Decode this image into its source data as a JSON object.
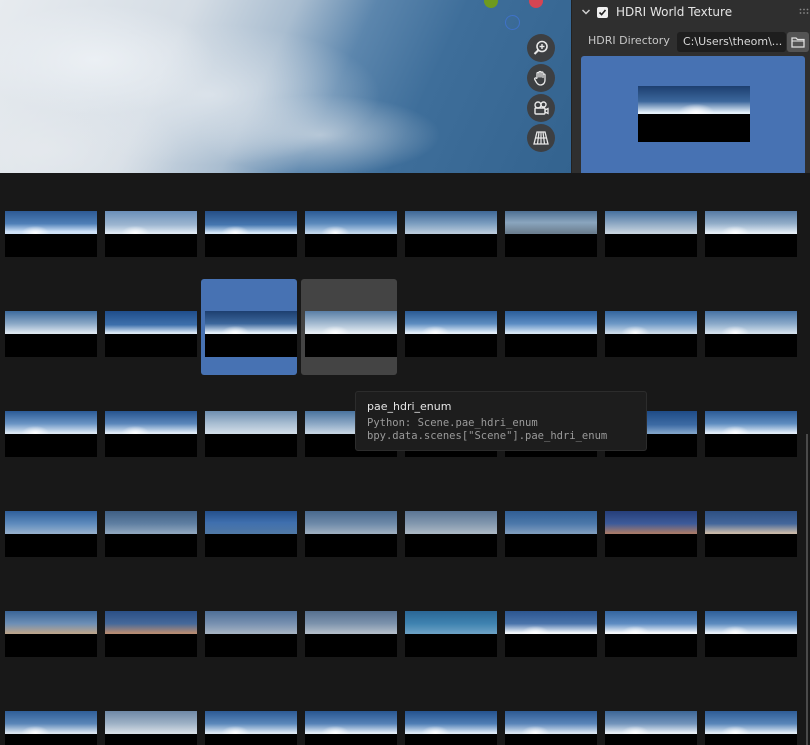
{
  "panel": {
    "header_title": "HDRI World Texture",
    "hdri_directory_label": "HDRI Directory",
    "hdri_directory_value": "C:\\Users\\theom\\...",
    "enabled": true
  },
  "viewport": {
    "icons": [
      "gizmo-y-axis",
      "gizmo-x-axis",
      "zoom-icon",
      "hand-icon",
      "camera-icon",
      "grid-icon"
    ]
  },
  "tooltip": {
    "title": "pae_hdri_enum",
    "python_line": "Python: Scene.pae_hdri_enum",
    "bpy_line": "bpy.data.scenes[\"Scene\"].pae_hdri_enum"
  },
  "grid": {
    "rows": [
      [
        {
          "sky": "linear-gradient(180deg,#2d5a94 0%,#4f7fb7 55%,#cfe2f7 90%)",
          "sun": true
        },
        {
          "sky": "linear-gradient(180deg,#6a8fb9 0%,#9db6d0 60%,#dfe9f3 95%)",
          "sun": true
        },
        {
          "sky": "linear-gradient(180deg,#254f87 0%,#4677b0 60%,#d7e8f8 95%)",
          "sun": true
        },
        {
          "sky": "linear-gradient(180deg,#2b5b95 0%,#5d8bbd 55%,#c0d5ea 95%)",
          "sun": true
        },
        {
          "sky": "linear-gradient(180deg,#3e6796 0%,#7c9ec0 55%,#b9cadb 95%)",
          "sun": false
        },
        {
          "sky": "linear-gradient(180deg,#4d6f92 0%,#8aa5be 50%,#6c7f90 95%)",
          "sun": false
        },
        {
          "sky": "linear-gradient(180deg,#45709f 0%,#8fa9c4 55%,#c7d3de 95%)",
          "sun": false
        },
        {
          "sky": "linear-gradient(180deg,#557aa4 0%,#93aec9 55%,#e4edf5 95%)",
          "sun": true
        }
      ],
      [
        {
          "sky": "linear-gradient(180deg,#3d6b9e 0%,#8ba8c6 55%,#dce6ef 95%)",
          "sun": false
        },
        {
          "sky": "linear-gradient(180deg,#1f4d8a 0%,#3d70ac 60%,#dbe8f4 95%)",
          "sun": false
        },
        {
          "sky": "linear-gradient(180deg,#1d3f70 0%,#3c679c 55%,#e5f0fa 95%)",
          "sun": true
        },
        {
          "sky": "linear-gradient(180deg,#597ea6 0%,#a5bbd1 55%,#e6edf3 95%)",
          "sun": true
        },
        {
          "sky": "linear-gradient(180deg,#2a5a94 0%,#5d8cc0 55%,#e3eef8 95%)",
          "sun": true
        },
        {
          "sky": "linear-gradient(180deg,#2b5e9a 0%,#5b8cc3 55%,#d6e5f3 95%)",
          "sun": false
        },
        {
          "sky": "linear-gradient(180deg,#33659e 0%,#6d98c6 55%,#cad9e7 95%)",
          "sun": true
        },
        {
          "sky": "linear-gradient(180deg,#4672a4 0%,#8aa9c9 55%,#d2dfeb 95%)",
          "sun": true
        }
      ],
      [
        {
          "sky": "linear-gradient(180deg,#2a5a96 0%,#6a94c4 55%,#dbe7f3 95%)",
          "sun": true
        },
        {
          "sky": "linear-gradient(180deg,#26548f 0%,#5b87bb 55%,#e0ebf6 95%)",
          "sun": true
        },
        {
          "sky": "linear-gradient(180deg,#6e8eb0 0%,#a9bed2 55%,#d0dce7 95%)",
          "sun": false
        },
        {
          "sky": "linear-gradient(180deg,#49739f 0%,#8ca8c5 55%,#c4d3e1 95%)",
          "sun": false
        },
        {
          "sky": "linear-gradient(180deg,#3d6592 0%,#7395b9 55%,#c5d3e0 95%)",
          "sun": false
        },
        {
          "sky": "linear-gradient(180deg,#2f5d93 0%,#6890bd 55%,#cbd9e6 95%)",
          "sun": false
        },
        {
          "sky": "linear-gradient(180deg,#1e4b86 0%,#3d6ba4 60%,#7fa2c8 95%)",
          "sun": false
        },
        {
          "sky": "linear-gradient(180deg,#2c5b96 0%,#5f8dc0 55%,#e1ecf7 95%)",
          "sun": true
        }
      ],
      [
        {
          "sky": "linear-gradient(180deg,#2f5f9b 0%,#5e8bbd 55%,#93aecb 95%)",
          "sun": false
        },
        {
          "sky": "linear-gradient(180deg,#3f5f84 0%,#5f7fa2 55%,#8ea5bd 95%)",
          "sun": false
        },
        {
          "sky": "linear-gradient(180deg,#24508c 0%,#3f6fae 50%,#4f78a6 95%)",
          "sun": false
        },
        {
          "sky": "linear-gradient(180deg,#49698e 0%,#6e8aa9 55%,#9cadbf 95%)",
          "sun": false
        },
        {
          "sky": "linear-gradient(180deg,#5b7594 0%,#8398ae 55%,#a9b6c3 95%)",
          "sun": false
        },
        {
          "sky": "linear-gradient(180deg,#305e94 0%,#4c78aa 55%,#7d9bbc 95%)",
          "sun": false
        },
        {
          "sky": "linear-gradient(180deg,#263f7a 0%,#3d5b9a 55%,#a67a6a 95%)",
          "sun": false
        },
        {
          "sky": "linear-gradient(180deg,#2d4f82 0%,#44679b 55%,#c8b8a8 95%)",
          "sun": false
        }
      ],
      [
        {
          "sky": "linear-gradient(180deg,#3a6597 0%,#6d8fb6 55%,#b9a48d 95%)",
          "sun": false
        },
        {
          "sky": "linear-gradient(180deg,#2a4f86 0%,#46699a 55%,#b58b73 95%)",
          "sun": false
        },
        {
          "sky": "linear-gradient(180deg,#4e6f97 0%,#7891b0 55%,#a3b1c1 95%)",
          "sun": false
        },
        {
          "sky": "linear-gradient(180deg,#56708f 0%,#7d93ad 55%,#b1bcc8 95%)",
          "sun": false
        },
        {
          "sky": "linear-gradient(180deg,#2a6796 0%,#3f83b0 55%,#6aa0c4 95%)",
          "sun": false
        },
        {
          "sky": "linear-gradient(180deg,#2c5690 0%,#4a74ab 55%,#f3f7fb 95%)",
          "sun": true
        },
        {
          "sky": "linear-gradient(180deg,#3466a0 0%,#5e8cc2 55%,#f5f8fb 95%)",
          "sun": true
        },
        {
          "sky": "linear-gradient(180deg,#2e5f9a 0%,#5c8bbf 55%,#e8f0f8 95%)",
          "sun": true
        }
      ],
      [
        {
          "sky": "linear-gradient(180deg,#2f5e98 0%,#5a86b8 55%,#d9e4ef 95%)",
          "sun": true
        },
        {
          "sky": "linear-gradient(180deg,#6e88a6 0%,#9fb2c6 55%,#d5dde5 95%)",
          "sun": false
        },
        {
          "sky": "linear-gradient(180deg,#2c5a94 0%,#5b88bb 55%,#dce8f3 95%)",
          "sun": true
        },
        {
          "sky": "linear-gradient(180deg,#285690 0%,#5682b7 55%,#e2ecf6 95%)",
          "sun": true
        },
        {
          "sky": "linear-gradient(180deg,#24528e 0%,#4f7eb5 55%,#dce9f6 95%)",
          "sun": true
        },
        {
          "sky": "linear-gradient(180deg,#2d5a93 0%,#5a85b9 55%,#d8e4f0 95%)",
          "sun": true
        },
        {
          "sky": "linear-gradient(180deg,#3c6696 0%,#7294bb 55%,#e7eef5 95%)",
          "sun": true
        },
        {
          "sky": "linear-gradient(180deg,#2e5c96 0%,#5986b9 55%,#e0ebf5 95%)",
          "sun": true
        }
      ]
    ],
    "selected_row": 1,
    "selected_col": 2,
    "hovered_row": 1,
    "hovered_col": 3
  },
  "colors": {
    "accent": "#4772b3",
    "background": "#181818",
    "panel": "#2f2f2f",
    "gizmo_y": "#6e9a1e",
    "gizmo_x": "#d64553"
  }
}
